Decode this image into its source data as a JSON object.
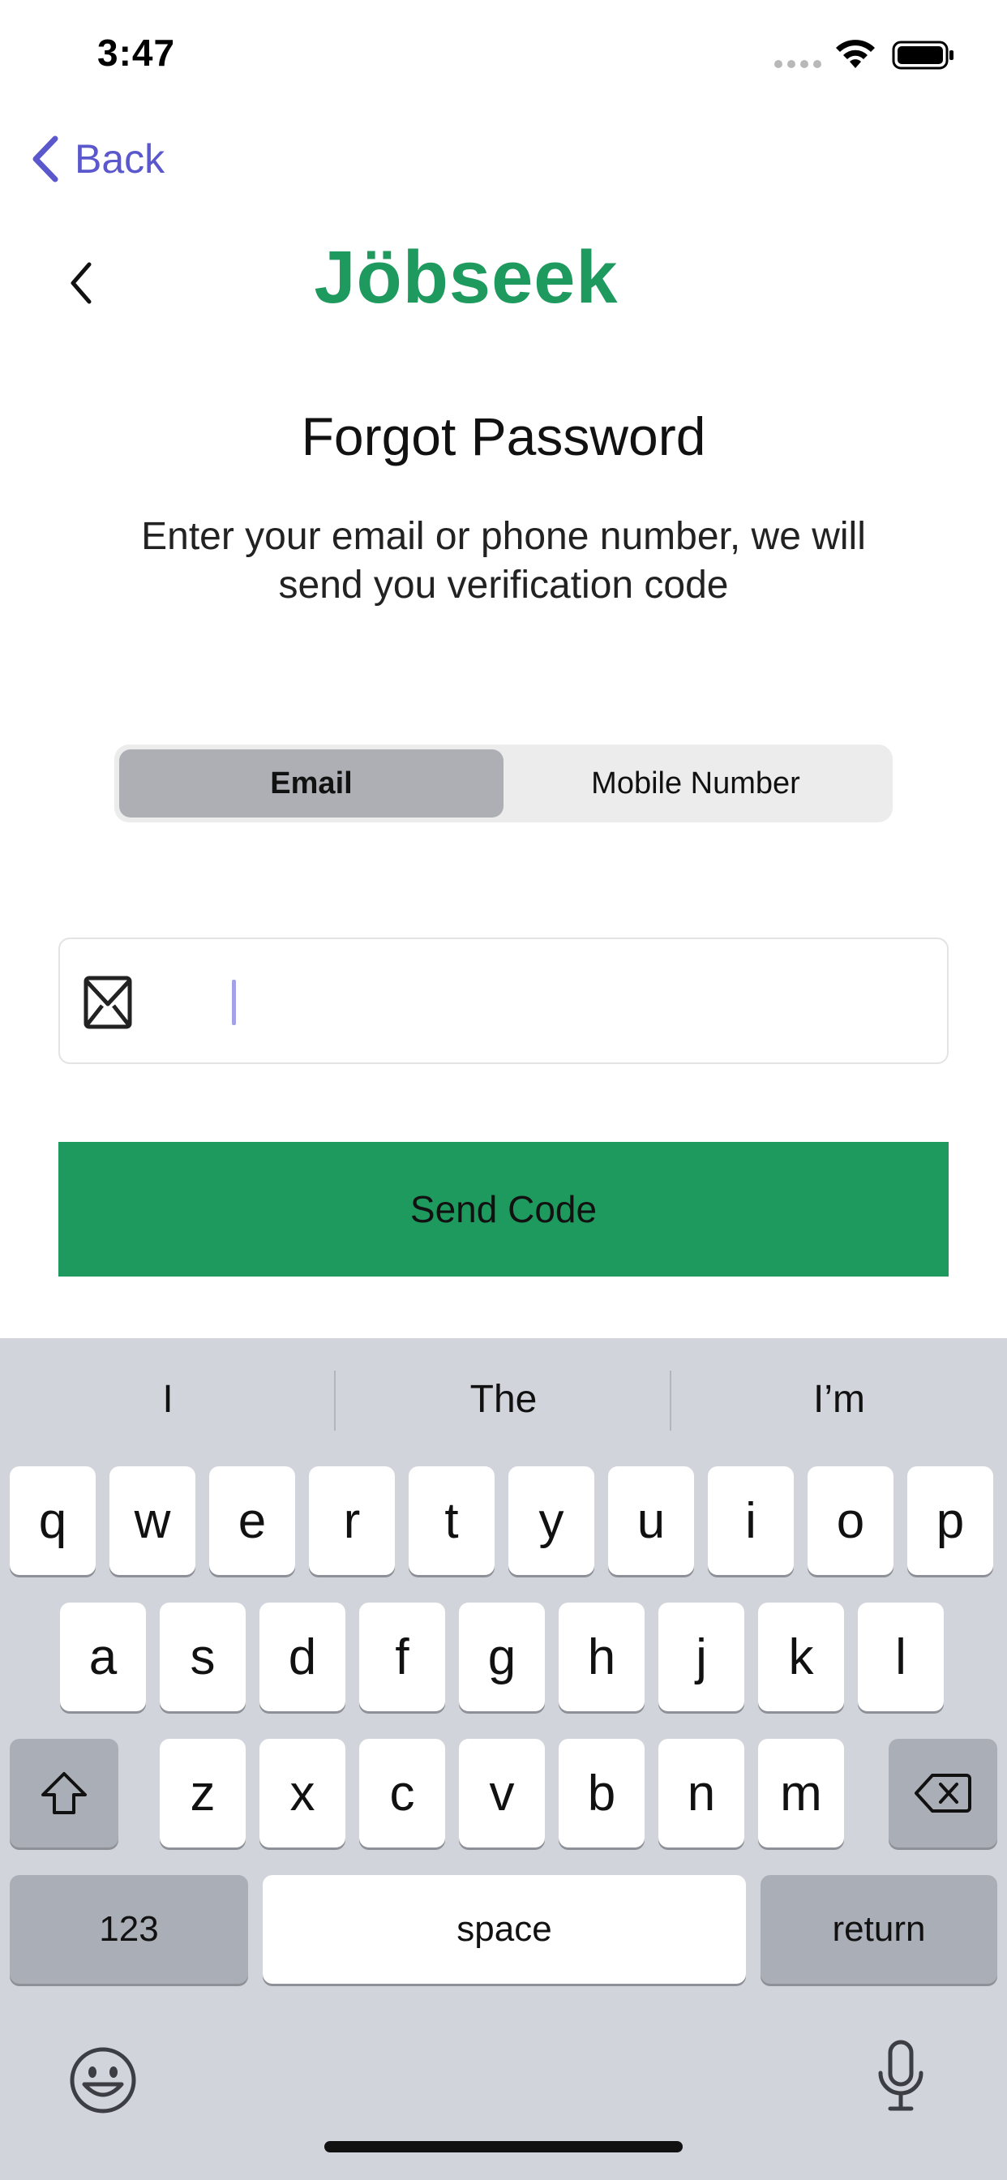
{
  "status_bar": {
    "time": "3:47"
  },
  "nav": {
    "back_label": "Back"
  },
  "header": {
    "brand": "Jöbseek"
  },
  "page": {
    "title": "Forgot Password",
    "subtitle_line1": "Enter your email or phone number, we will",
    "subtitle_line2": "send you verification code"
  },
  "segmented": {
    "options": [
      "Email",
      "Mobile Number"
    ],
    "selected": "Email"
  },
  "email_field": {
    "value": "",
    "placeholder": ""
  },
  "send_button": {
    "label": "Send Code"
  },
  "keyboard": {
    "suggestions": [
      "I",
      "The",
      "I’m"
    ],
    "row1": [
      "q",
      "w",
      "e",
      "r",
      "t",
      "y",
      "u",
      "i",
      "o",
      "p"
    ],
    "row2": [
      "a",
      "s",
      "d",
      "f",
      "g",
      "h",
      "j",
      "k",
      "l"
    ],
    "row3": [
      "z",
      "x",
      "c",
      "v",
      "b",
      "n",
      "m"
    ],
    "numbers_label": "123",
    "space_label": "space",
    "return_label": "return"
  },
  "colors": {
    "brand_green": "#1e9a5f",
    "link_purple": "#5b57cc",
    "keyboard_bg": "#d1d4da"
  },
  "icons": [
    "wifi-icon",
    "battery-icon",
    "back-chevron-icon",
    "mail-icon",
    "shift-icon",
    "delete-icon",
    "emoji-icon",
    "microphone-icon"
  ]
}
